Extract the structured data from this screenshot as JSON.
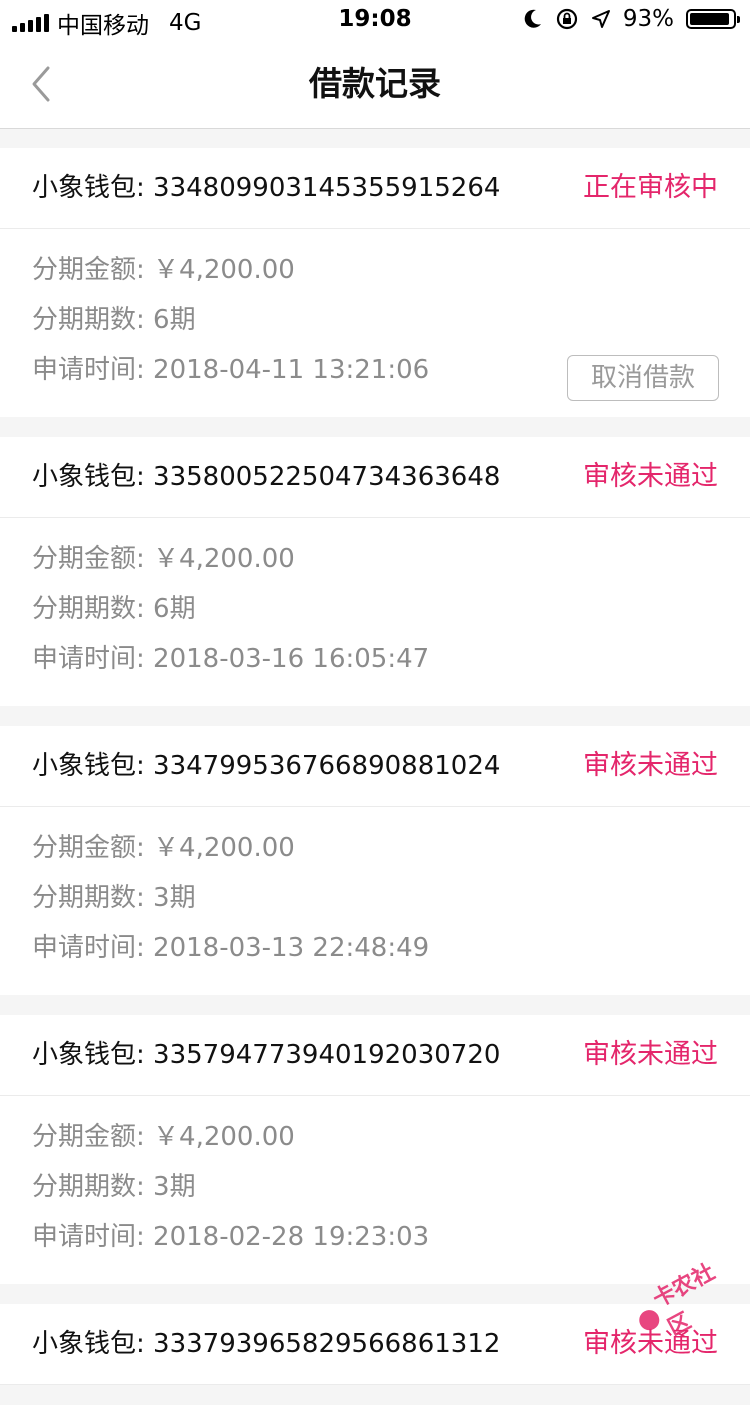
{
  "status_bar": {
    "carrier": "中国移动",
    "network": "4G",
    "time": "19:08",
    "battery": "93%",
    "battery_level": 0.93
  },
  "nav": {
    "title": "借款记录"
  },
  "labels": {
    "amount": "分期金额: ",
    "periods": "分期期数: ",
    "time": "申请时间: ",
    "cancel": "取消借款"
  },
  "records": [
    {
      "name": "小象钱包: 334809903145355915264",
      "status": "正在审核中",
      "amount": "￥4,200.00",
      "periods": "6期",
      "time": "2018-04-11 13:21:06"
    },
    {
      "name": "小象钱包: 335800522504734363648",
      "status": "审核未通过",
      "amount": "￥4,200.00",
      "periods": "6期",
      "time": "2018-03-16 16:05:47"
    },
    {
      "name": "小象钱包: 334799536766890881024",
      "status": "审核未通过",
      "amount": "￥4,200.00",
      "periods": "3期",
      "time": "2018-03-13 22:48:49"
    },
    {
      "name": "小象钱包: 335794773940192030720",
      "status": "审核未通过",
      "amount": "￥4,200.00",
      "periods": "3期",
      "time": "2018-02-28 19:23:03"
    },
    {
      "name": "小象钱包: 333793965829566861312",
      "status": "审核未通过"
    }
  ],
  "watermark": "卡农社区",
  "colors": {
    "accent": "#e4266b",
    "secondary_text": "#8b8b8b",
    "background": "#f5f5f5"
  }
}
